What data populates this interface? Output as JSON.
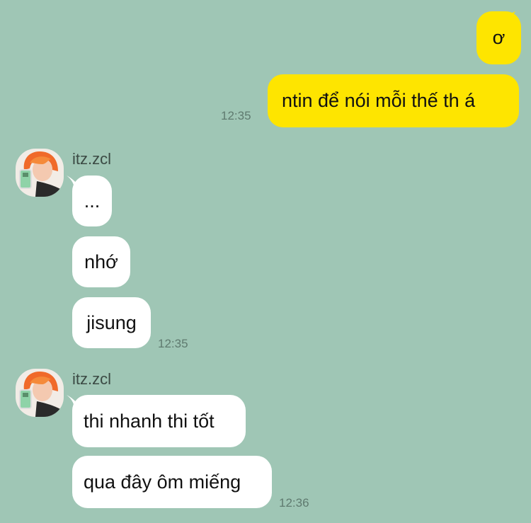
{
  "chat": {
    "outgoing": [
      {
        "text": "ơ"
      },
      {
        "text": "ntin để nói mỗi thế th á",
        "time": "12:35"
      }
    ],
    "groups": [
      {
        "sender": "itz.zcl",
        "avatar_icon": "profile-photo-orange-hair",
        "messages": [
          "...",
          "nhớ",
          "jisung"
        ],
        "time": "12:35"
      },
      {
        "sender": "itz.zcl",
        "avatar_icon": "profile-photo-orange-hair",
        "messages": [
          "thi nhanh thi tốt",
          "qua đây ôm miếng"
        ],
        "time": "12:36"
      }
    ]
  },
  "colors": {
    "background": "#9fc6b5",
    "outgoing_bubble": "#fee500",
    "incoming_bubble": "#ffffff",
    "timestamp": "#5f7a6f"
  }
}
